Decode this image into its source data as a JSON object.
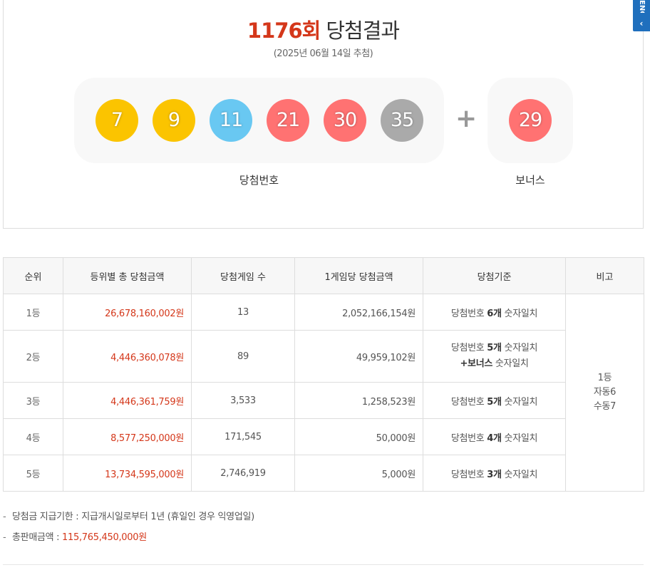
{
  "header": {
    "round": "1176회",
    "title_suffix": "당첨결과",
    "date": "(2025년 06월 14일 추첨)"
  },
  "side_tab": {
    "label": "ENG",
    "chevron": "‹"
  },
  "winning_numbers": [
    {
      "number": "7",
      "color": "#fbc400"
    },
    {
      "number": "9",
      "color": "#fbc400"
    },
    {
      "number": "11",
      "color": "#69c8f2"
    },
    {
      "number": "21",
      "color": "#ff7272"
    },
    {
      "number": "30",
      "color": "#ff7272"
    },
    {
      "number": "35",
      "color": "#aaaaaa"
    }
  ],
  "plus_sign": "+",
  "bonus": {
    "number": "29",
    "color": "#ff7272"
  },
  "labels": {
    "winning": "당첨번호",
    "bonus": "보너스"
  },
  "table": {
    "headers": [
      "순위",
      "등위별 총 당첨금액",
      "당첨게임 수",
      "1게임당 당첨금액",
      "당첨기준",
      "비고"
    ],
    "rows": [
      {
        "rank": "1등",
        "total": "26,678,160,002원",
        "games": "13",
        "per_game": "2,052,166,154원",
        "crit_pre": "당첨번호 ",
        "crit_bold": "6개",
        "crit_post": " 숫자일치"
      },
      {
        "rank": "2등",
        "total": "4,446,360,078원",
        "games": "89",
        "per_game": "49,959,102원",
        "crit_pre": "당첨번호 ",
        "crit_bold": "5개",
        "crit_post": " 숫자일치",
        "crit2_bold": "+보너스",
        "crit2_post": " 숫자일치"
      },
      {
        "rank": "3등",
        "total": "4,446,361,759원",
        "games": "3,533",
        "per_game": "1,258,523원",
        "crit_pre": "당첨번호 ",
        "crit_bold": "5개",
        "crit_post": " 숫자일치"
      },
      {
        "rank": "4등",
        "total": "8,577,250,000원",
        "games": "171,545",
        "per_game": "50,000원",
        "crit_pre": "당첨번호 ",
        "crit_bold": "4개",
        "crit_post": " 숫자일치"
      },
      {
        "rank": "5등",
        "total": "13,734,595,000원",
        "games": "2,746,919",
        "per_game": "5,000원",
        "crit_pre": "당첨번호 ",
        "crit_bold": "3개",
        "crit_post": " 숫자일치"
      }
    ],
    "note": [
      "1등",
      "자동6",
      "수동7"
    ]
  },
  "footer_notes": {
    "deadline_label": "당첨금 지급기한 : ",
    "deadline_value": "지급개시일로부터 1년 (휴일인 경우 익영업일)",
    "sales_label": "총판매금액 : ",
    "sales_value": "115,765,450,000원"
  }
}
